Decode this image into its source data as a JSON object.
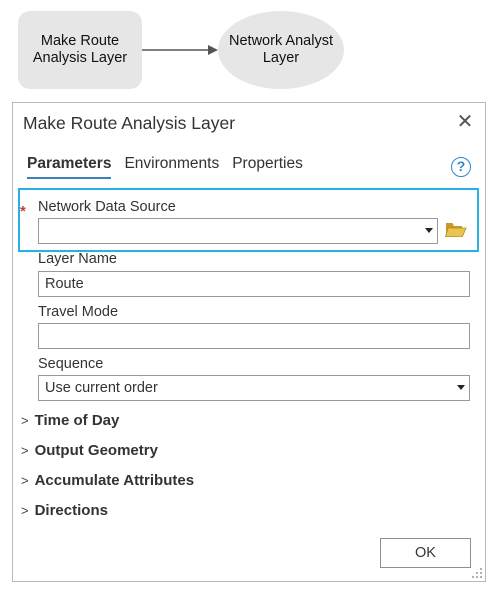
{
  "diagram": {
    "tool_node": {
      "line1": "Make Route",
      "line2": "Analysis Layer"
    },
    "output_node": {
      "line1": "Network Analyst",
      "line2": "Layer"
    }
  },
  "dialog": {
    "title": "Make Route Analysis Layer",
    "close_icon": "close-icon",
    "tabs": [
      {
        "label": "Parameters",
        "active": true
      },
      {
        "label": "Environments",
        "active": false
      },
      {
        "label": "Properties",
        "active": false
      }
    ],
    "help_icon": "help-icon",
    "help_glyph": "?",
    "fields": {
      "network_data_source": {
        "label": "Network Data Source",
        "value": "",
        "required": true,
        "required_mark": "*"
      },
      "layer_name": {
        "label": "Layer Name",
        "value": "Route"
      },
      "travel_mode": {
        "label": "Travel Mode",
        "value": ""
      },
      "sequence": {
        "label": "Sequence",
        "value": "Use current order"
      }
    },
    "sections": [
      {
        "label": "Time of Day"
      },
      {
        "label": "Output Geometry"
      },
      {
        "label": "Accumulate Attributes"
      },
      {
        "label": "Directions"
      }
    ],
    "ok_label": "OK"
  },
  "colors": {
    "highlight": "#29b0e3",
    "required": "#c4412b",
    "tab_underline": "#3a83b8",
    "folder": "#d9b23a",
    "node_fill": "#e6e6e6"
  }
}
